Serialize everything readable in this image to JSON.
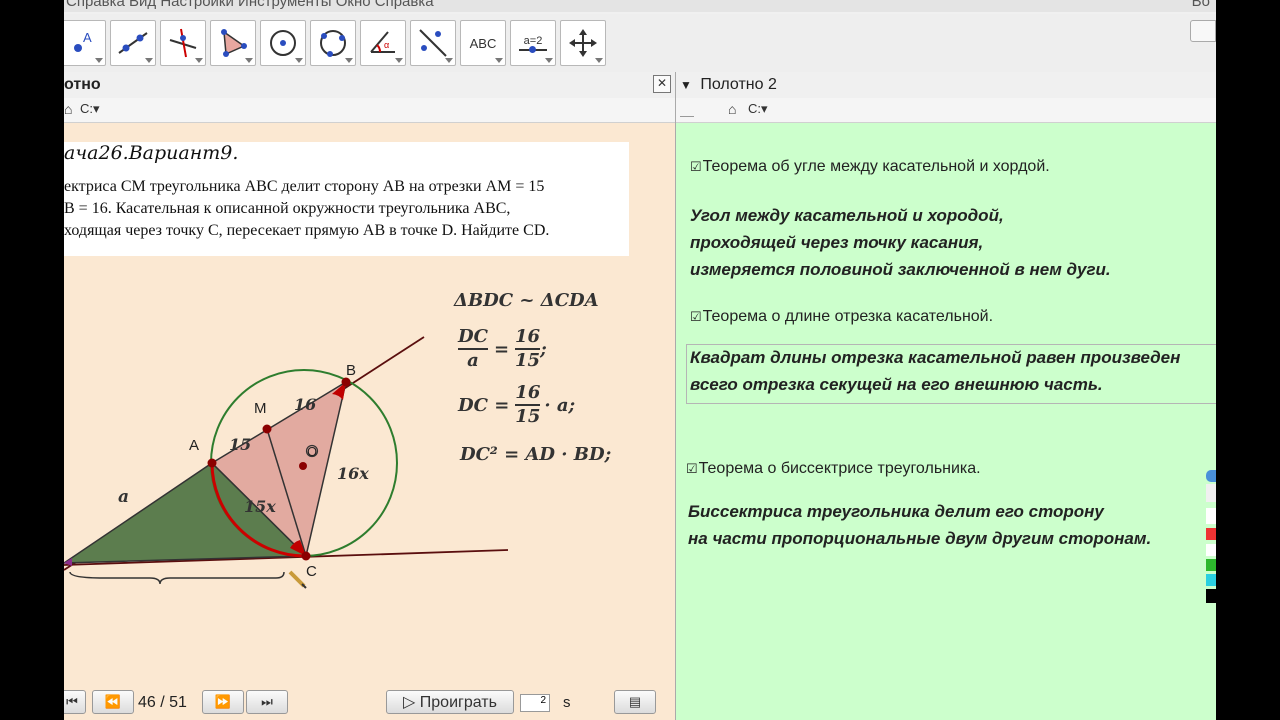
{
  "menubar": {
    "items": "Справка  Вид  Настройки  Инструменты  Окно  Справка",
    "right": "Во"
  },
  "toolbar": {
    "tools": [
      {
        "name": "move-tool-icon"
      },
      {
        "name": "point-tool-icon"
      },
      {
        "name": "line-tool-icon"
      },
      {
        "name": "perpendicular-tool-icon"
      },
      {
        "name": "polygon-tool-icon"
      },
      {
        "name": "circle-center-tool-icon"
      },
      {
        "name": "circle-three-points-tool-icon"
      },
      {
        "name": "angle-tool-icon"
      },
      {
        "name": "reflect-tool-icon"
      },
      {
        "name": "text-tool-icon",
        "label": "ABC"
      },
      {
        "name": "slider-tool-icon",
        "label": "a=2"
      },
      {
        "name": "move-view-tool-icon"
      }
    ]
  },
  "left_pane": {
    "title": "отно",
    "close": "✕",
    "problem_title": "ача26.Вариант9.",
    "problem_lines": [
      "ектриса CM треугольника ABC делит сторону AB на отрезки AM = 15",
      "B = 16. Касательная к описанной окружности треугольника ABC,",
      "ходящая через точку C, пересекает прямую AB в точке D. Найдите CD."
    ],
    "formulas": {
      "similarity": "ΔBDC ~ ΔCDA",
      "ratio_num": "DC",
      "ratio_den": "a",
      "eq": "=",
      "frac_num": "16",
      "frac_den": "15",
      "semicolon": ";",
      "dc_eq": "DC =",
      "times_a": "· a;",
      "dc_sq": "DC² = AD · BD;"
    },
    "labels": {
      "B": "B",
      "M": "M",
      "A": "A",
      "O": "O",
      "C": "C",
      "seg_15": "15",
      "seg_16": "16",
      "seg_16x": "16x",
      "seg_15x": "15x",
      "seg_a": "a"
    }
  },
  "nav": {
    "counter": "46 / 51",
    "play": "▷ Проиграть",
    "speed": "2",
    "unit": "s"
  },
  "right_pane": {
    "title": "Полотно 2",
    "theorems": [
      {
        "title": "Теорема об угле между касательной и хордой.",
        "lines": [
          "Угол между касательной и хородой,",
          "проходящей через точку касания,",
          "измеряется половиной заключенной в нем дуги."
        ]
      },
      {
        "title": "Теорема о длине отрезка касательной.",
        "lines": [
          "Квадрат длины отрезка касательной равен произведен",
          "всего отрезка секущей на его внешнюю часть."
        ]
      },
      {
        "title": "Теорема о биссектрисе треугольника.",
        "lines": [
          "Биссектриса треугольника делит его сторону",
          "на части пропорциональные двум другим сторонам."
        ]
      }
    ],
    "checkbox": "☑"
  },
  "colors": {
    "left_bg": "#fbe8d2",
    "right_bg": "#ccffcc",
    "triangle_green": "#5c7d4e",
    "triangle_pink": "#e2aaa0",
    "circle": "#2e7d2e",
    "point": "#8b0000"
  }
}
